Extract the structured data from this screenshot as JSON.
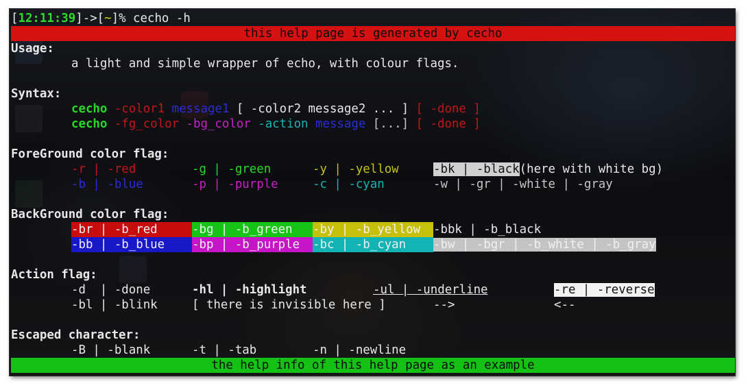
{
  "prompt": {
    "open": "[",
    "time": "12:11:39",
    "close_arrow": "]->[",
    "cwd": "~",
    "tail": "]%",
    "command": " cecho -h"
  },
  "banner_top": "this help page is generated by cecho",
  "usage": {
    "title": "Usage:",
    "text": "a light and simple wrapper of echo, with colour flags."
  },
  "syntax": {
    "title": "Syntax:",
    "line1": {
      "cmd": "cecho",
      "a": " -color1",
      "b": " message1",
      "c": " [ -color2 message2 ... ]",
      "d": " [ -done ]"
    },
    "line2": {
      "cmd": "cecho",
      "a": " -fg_color",
      "b": " -bg_color",
      "c": " -action",
      "d": " message",
      "e": " [...]",
      "f": " [ -done ]"
    }
  },
  "fg": {
    "title": "ForeGround color flag:",
    "red": "-r | -red",
    "green": "-g | -green",
    "yellow": "-y | -yellow",
    "black": "-bk | -black",
    "black_note": "(here with white bg)",
    "blue": "-b | -blue",
    "purple": "-p | -purple",
    "cyan": "-c | -cyan",
    "white": "-w | -gr | -white | -gray"
  },
  "bg": {
    "title": "BackGround color flag:",
    "red": "-br | -b_red",
    "green": "-bg | -b_green",
    "yellow": "-by | -b_yellow",
    "black": "-bbk | -b_black",
    "blue": "-bb | -b_blue",
    "purple": "-bp | -b_purple",
    "cyan": "-bc | -b_cyan",
    "white": "-bw | -bgr | -b_white | -b_gray"
  },
  "action": {
    "title": "Action flag:",
    "done": "-d  | -done",
    "highlight": "-hl | -highlight",
    "underline": "-ul | -underline",
    "reverse": "-re | -reverse",
    "blink": "-bl | -blink",
    "invisible": "[ there is invisible here ]",
    "arrow_right": "-->",
    "arrow_left": "<--"
  },
  "escaped": {
    "title": "Escaped character:",
    "blank": "-B | -blank",
    "tab": "-t | -tab",
    "newline": "-n | -newline"
  },
  "banner_bottom": "the help info of this help page as an example",
  "colors": {
    "red": "#d41212",
    "green": "#16c116",
    "yellow": "#c6c00c",
    "blue": "#1818c8",
    "purple": "#c615c6",
    "cyan": "#11b3b3",
    "gray": "#c4c4c4",
    "terminal_bg": "#0f1114"
  }
}
